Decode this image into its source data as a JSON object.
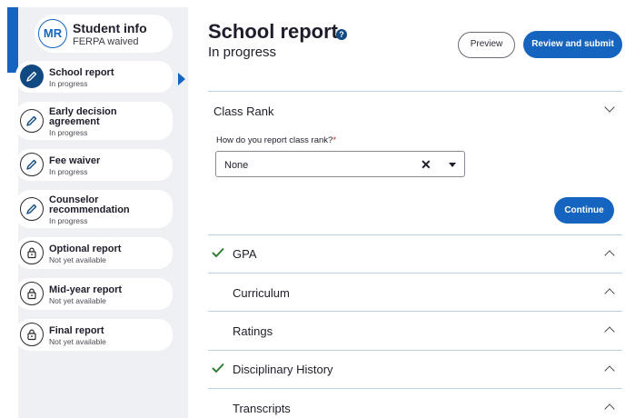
{
  "student": {
    "initials": "MR",
    "name": "Student info",
    "ferpa": "FERPA waived"
  },
  "sidebar": {
    "items": [
      {
        "title_lines": [
          "School report"
        ],
        "status": "In progress",
        "icon": "pencil-icon",
        "active": true
      },
      {
        "title_lines": [
          "Early decision",
          "agreement"
        ],
        "status": "In progress",
        "icon": "pencil-icon"
      },
      {
        "title_lines": [
          "Fee waiver"
        ],
        "status": "In progress",
        "icon": "pencil-icon"
      },
      {
        "title_lines": [
          "Counselor",
          "recommendation"
        ],
        "status": "In progress",
        "icon": "pencil-icon"
      },
      {
        "title_lines": [
          "Optional report"
        ],
        "status": "Not yet available",
        "icon": "lock-icon"
      },
      {
        "title_lines": [
          "Mid-year report"
        ],
        "status": "Not yet available",
        "icon": "lock-icon"
      },
      {
        "title_lines": [
          "Final report"
        ],
        "status": "Not yet available",
        "icon": "lock-icon"
      }
    ]
  },
  "header": {
    "title": "School report",
    "help_glyph": "?",
    "status": "In progress",
    "preview_label": "Preview",
    "submit_label": "Review and submit"
  },
  "class_rank": {
    "title": "Class Rank",
    "question": "How do you report class rank?",
    "required_mark": "*",
    "selected": "None",
    "clear_glyph": "✕",
    "continue_label": "Continue"
  },
  "sections": [
    {
      "title": "GPA",
      "complete": true
    },
    {
      "title": "Curriculum",
      "complete": false
    },
    {
      "title": "Ratings",
      "complete": false
    },
    {
      "title": "Disciplinary History",
      "complete": true
    },
    {
      "title": "Transcripts",
      "complete": false
    }
  ],
  "colors": {
    "primary": "#1565c0",
    "dark_blue": "#114a82",
    "check_green": "#2e7d32",
    "sidebar_bg": "#eef0f3"
  }
}
